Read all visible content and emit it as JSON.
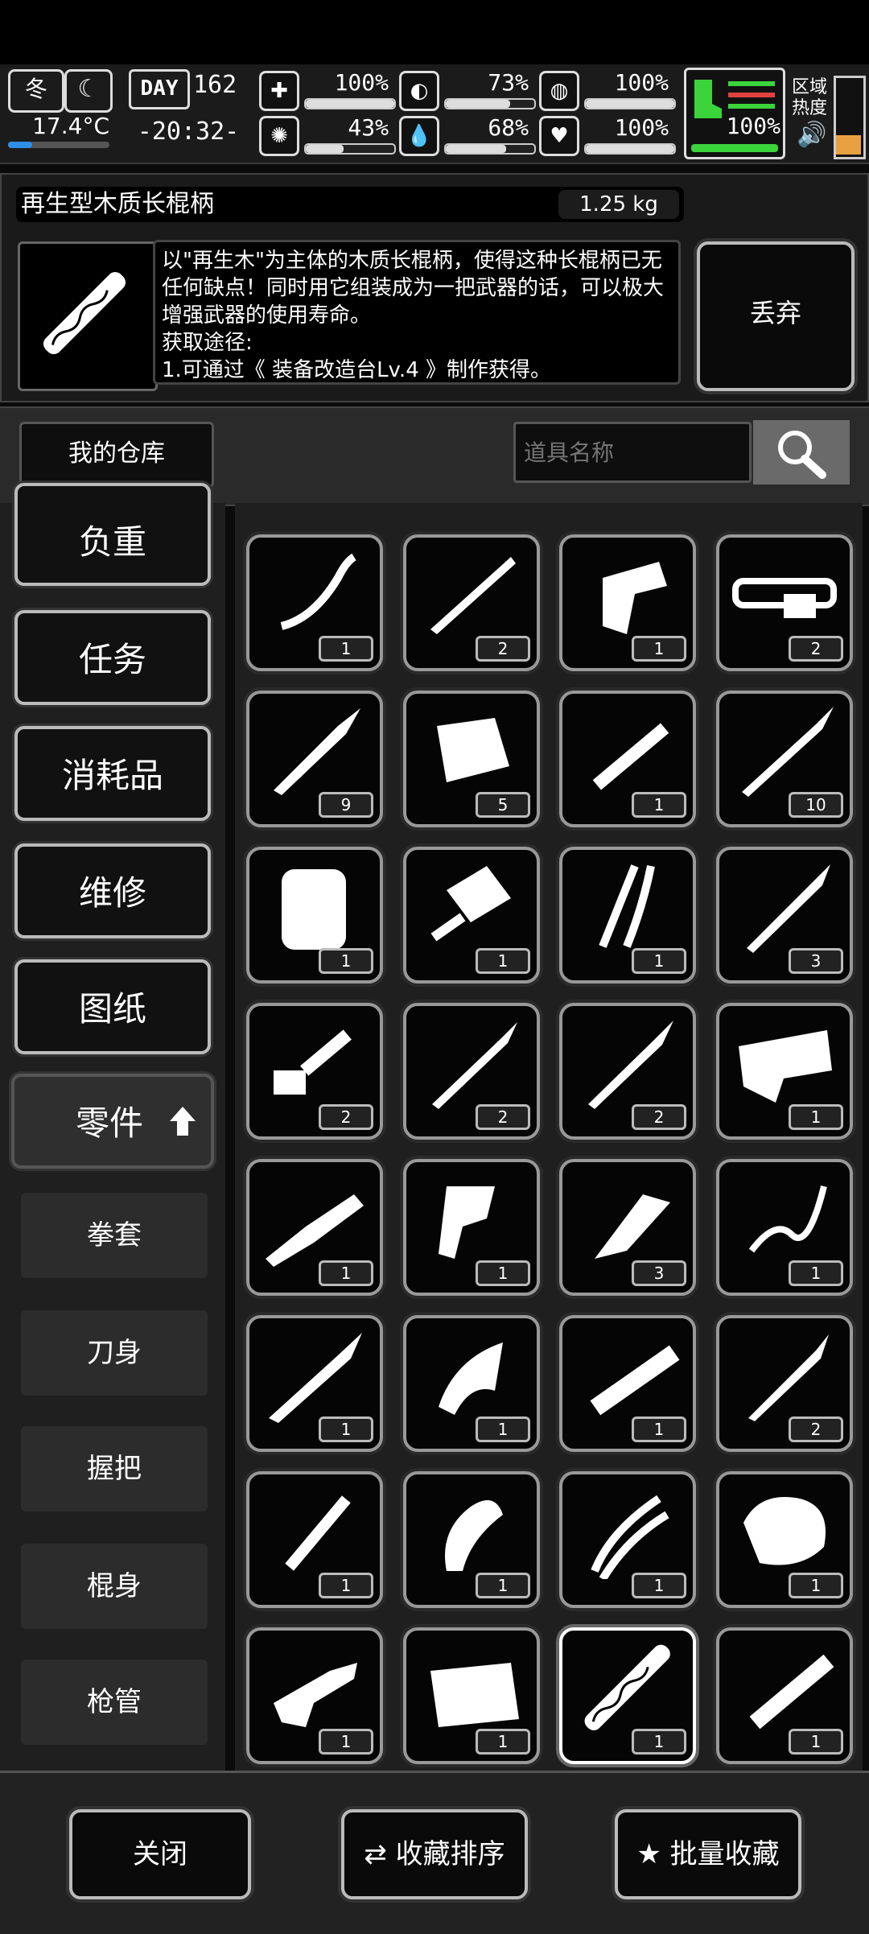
{
  "hud": {
    "season": "冬",
    "moon_icon": "moon-icon",
    "temperature": "17.4°C",
    "day_label": "DAY",
    "day_number": "162",
    "clock": "-20:32-",
    "stats": [
      {
        "icon": "medkit-icon",
        "glyph": "✚",
        "value": "100%",
        "level": 1.0
      },
      {
        "icon": "stomach-icon",
        "glyph": "◐",
        "value": "73%",
        "level": 0.73
      },
      {
        "icon": "shield-icon",
        "glyph": "◍",
        "value": "100%",
        "level": 1.0
      },
      {
        "icon": "virus-icon",
        "glyph": "✺",
        "value": "43%",
        "level": 0.43
      },
      {
        "icon": "water-drop-icon",
        "glyph": "💧",
        "value": "68%",
        "level": 0.68
      },
      {
        "icon": "heart-icon",
        "glyph": "♥",
        "value": "100%",
        "level": 1.0
      }
    ],
    "stamina_value": "100%",
    "zone_label": "区域热度",
    "accent": "#3bd43b"
  },
  "item": {
    "name": "再生型木质长棍柄",
    "weight": "1.25 kg",
    "description": "以\"再生木\"为主体的木质长棍柄，使得这种长棍柄已无任何缺点！同时用它组装成为一把武器的话，可以极大增强武器的使用寿命。\n获取途径:\n1.可通过《 装备改造台Lv.4 》制作获得。",
    "discard_label": "丢弃"
  },
  "warehouse": {
    "label": "我的仓库",
    "search_placeholder": "道具名称"
  },
  "categories": [
    {
      "label": "负重"
    },
    {
      "label": "任务"
    },
    {
      "label": "消耗品"
    },
    {
      "label": "维修"
    },
    {
      "label": "图纸"
    },
    {
      "label": "零件"
    }
  ],
  "subcategories": [
    {
      "label": "拳套"
    },
    {
      "label": "刀身"
    },
    {
      "label": "握把"
    },
    {
      "label": "棍身"
    },
    {
      "label": "枪管"
    }
  ],
  "grid": [
    {
      "icon": "bow-limb-icon",
      "qty": "1"
    },
    {
      "icon": "serrated-blade-icon",
      "qty": "2"
    },
    {
      "icon": "pistol-grip-icon",
      "qty": "1"
    },
    {
      "icon": "belt-icon",
      "qty": "2"
    },
    {
      "icon": "dagger-blade-icon",
      "qty": "9"
    },
    {
      "icon": "axe-head-icon",
      "qty": "5"
    },
    {
      "icon": "barrel-icon",
      "qty": "1"
    },
    {
      "icon": "spear-head-icon",
      "qty": "10"
    },
    {
      "icon": "armor-plate-icon",
      "qty": "1"
    },
    {
      "icon": "shovel-head-icon",
      "qty": "1"
    },
    {
      "icon": "claw-glove-icon",
      "qty": "1"
    },
    {
      "icon": "knife-blade-icon",
      "qty": "3"
    },
    {
      "icon": "short-barrel-icon",
      "qty": "2"
    },
    {
      "icon": "leaf-blade-icon",
      "qty": "2"
    },
    {
      "icon": "jagged-blade-icon",
      "qty": "2"
    },
    {
      "icon": "trigger-assembly-icon",
      "qty": "1"
    },
    {
      "icon": "machete-blade-icon",
      "qty": "1"
    },
    {
      "icon": "gun-grip-icon",
      "qty": "1"
    },
    {
      "icon": "cleaver-icon",
      "qty": "3"
    },
    {
      "icon": "chain-part-icon",
      "qty": "1"
    },
    {
      "icon": "ornate-blade-icon",
      "qty": "1"
    },
    {
      "icon": "hook-blade-icon",
      "qty": "1"
    },
    {
      "icon": "rail-barrel-icon",
      "qty": "1"
    },
    {
      "icon": "curved-knife-icon",
      "qty": "2"
    },
    {
      "icon": "stick-icon",
      "qty": "1"
    },
    {
      "icon": "wood-grip-icon",
      "qty": "1"
    },
    {
      "icon": "twin-limb-icon",
      "qty": "1"
    },
    {
      "icon": "rock-icon",
      "qty": "1"
    },
    {
      "icon": "pistol-frame-icon",
      "qty": "1"
    },
    {
      "icon": "patched-armor-icon",
      "qty": "1"
    },
    {
      "icon": "wooden-long-handle-icon",
      "qty": "1",
      "selected": true
    },
    {
      "icon": "metal-pipe-icon",
      "qty": "1"
    }
  ],
  "bottom": {
    "close_label": "关闭",
    "sort_label": "收藏排序",
    "batch_label": "批量收藏"
  }
}
